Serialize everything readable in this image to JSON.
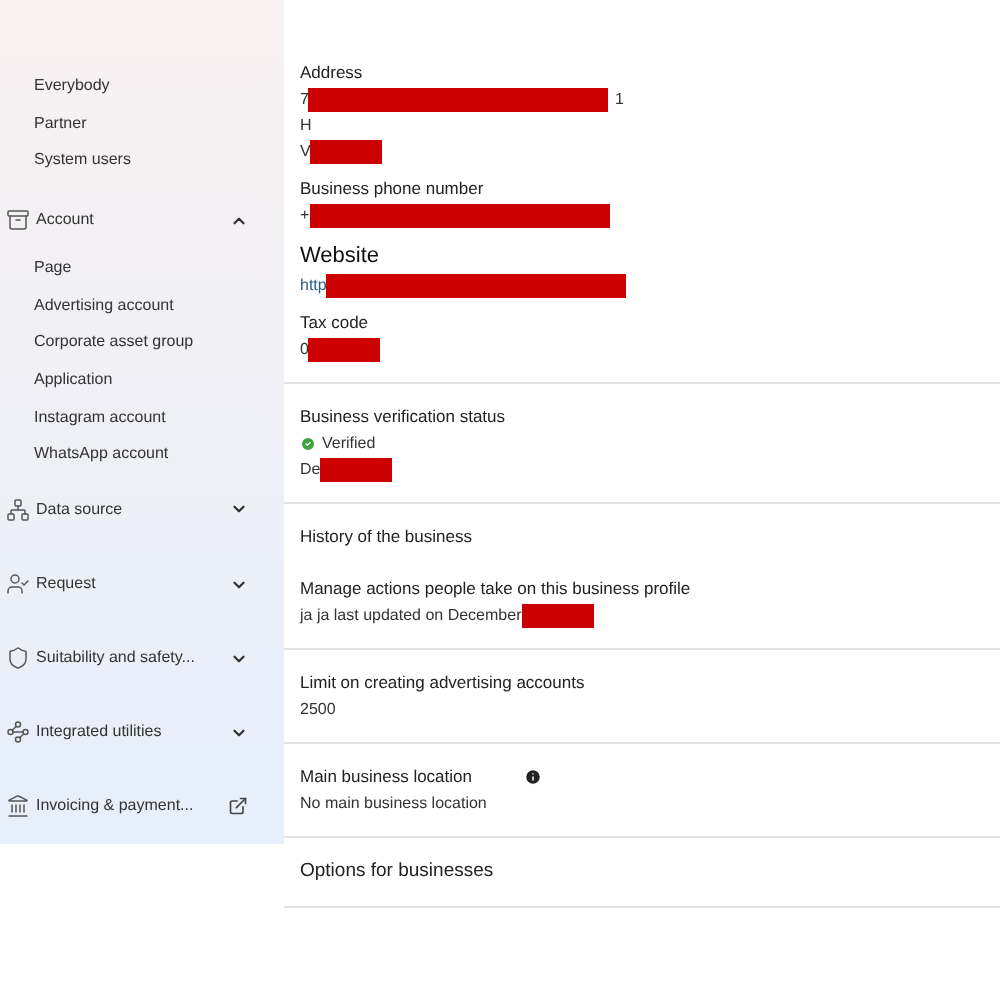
{
  "sidebar": {
    "items": [
      {
        "kind": "link",
        "label": "Everybody"
      },
      {
        "kind": "link",
        "label": "Partner"
      },
      {
        "kind": "link",
        "label": "System users"
      },
      {
        "kind": "group",
        "label": "Account",
        "expanded": true
      },
      {
        "kind": "link",
        "label": "Page"
      },
      {
        "kind": "link",
        "label": "Advertising account"
      },
      {
        "kind": "link",
        "label": "Corporate asset group"
      },
      {
        "kind": "link",
        "label": "Application"
      },
      {
        "kind": "link",
        "label": "Instagram account"
      },
      {
        "kind": "link",
        "label": "WhatsApp account"
      },
      {
        "kind": "group",
        "label": "Data source",
        "expanded": false
      },
      {
        "kind": "group",
        "label": "Request",
        "expanded": false
      },
      {
        "kind": "group",
        "label": "Suitability and safety...",
        "expanded": false
      },
      {
        "kind": "group",
        "label": "Integrated utilities",
        "expanded": false
      },
      {
        "kind": "external",
        "label": "Invoicing & payment..."
      }
    ]
  },
  "sections": [
    {
      "fields": [
        {
          "label": "Address",
          "heading": false,
          "lines": [
            {
              "prefix": "7",
              "redacted": true,
              "suffix": "1"
            },
            {
              "prefix": "H",
              "redacted": false
            },
            {
              "prefix": "V",
              "redacted": true
            }
          ]
        },
        {
          "label": "Business phone number",
          "heading": false,
          "lines": [
            {
              "prefix": "+",
              "redacted": true
            }
          ]
        },
        {
          "label": "Website",
          "heading": true,
          "lines": [
            {
              "prefix": "http",
              "redacted": true,
              "link": true
            }
          ]
        },
        {
          "label": "Tax code",
          "heading": false,
          "lines": [
            {
              "prefix": "0",
              "redacted": true
            }
          ]
        }
      ]
    },
    {
      "fields": [
        {
          "label": "Business verification status",
          "heading": false,
          "status": "Verified",
          "lines": [
            {
              "prefix": "De",
              "redacted": true
            }
          ]
        }
      ]
    },
    {
      "fields": [
        {
          "label": "History of the business",
          "heading": false
        },
        {
          "label": "Manage actions people take on this business profile",
          "heading": false,
          "lines": [
            {
              "prefix": "ja ja last updated on December",
              "redacted": true
            }
          ]
        }
      ]
    },
    {
      "fields": [
        {
          "label": "Limit on creating advertising accounts",
          "heading": false,
          "lines": [
            {
              "prefix": "2500",
              "redacted": false
            }
          ]
        }
      ]
    },
    {
      "fields": [
        {
          "label": "Main business location",
          "heading": false,
          "info": true,
          "lines": [
            {
              "prefix": "No main business location",
              "redacted": false
            }
          ]
        }
      ]
    },
    {
      "fields": [
        {
          "label": "Options for businesses",
          "heading": true
        }
      ]
    }
  ]
}
